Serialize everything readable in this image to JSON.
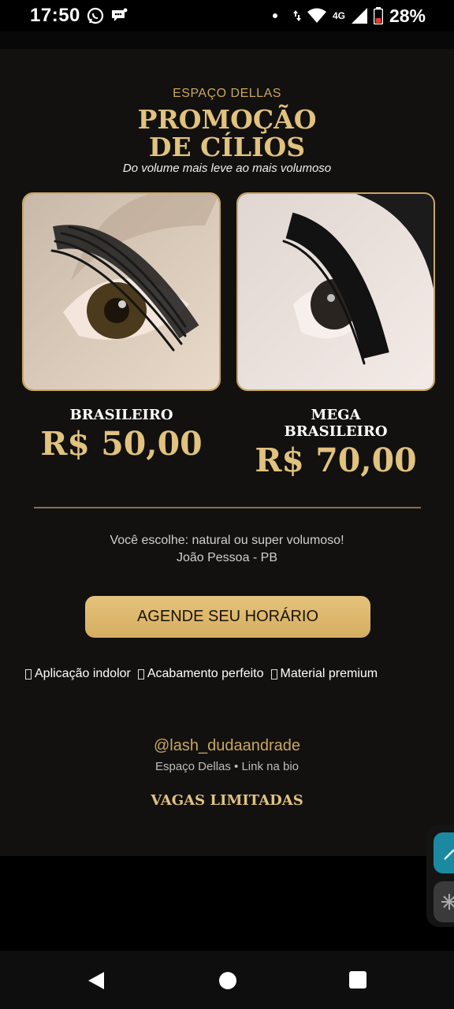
{
  "status_bar": {
    "time": "17:50",
    "network": "4G",
    "battery": "28%",
    "icons": [
      "whatsapp-icon",
      "message-icon",
      "dot-icon",
      "data-arrows-icon",
      "wifi-icon",
      "signal-icon",
      "battery-icon"
    ]
  },
  "promo": {
    "brand": "ESPAÇO DELLAS",
    "title_line1": "PROMOÇÃO",
    "title_line2": "DE CÍLIOS",
    "subtitle": "Do volume mais leve ao mais volumoso",
    "options": [
      {
        "name": "BRASILEIRO",
        "price": "R$ 50,00"
      },
      {
        "name_line1": "MEGA",
        "name_line2": "BRASILEIRO",
        "price": "R$ 70,00"
      }
    ],
    "tagline": "Você escolhe: natural ou super volumoso!",
    "location": "João Pessoa - PB",
    "cta": "AGENDE SEU HORÁRIO",
    "features": [
      "Aplicação indolor",
      "Acabamento perfeito",
      "Material premium"
    ],
    "handle": "@lash_dudaandrade",
    "info": "Espaço Dellas • Link na bio",
    "footer": "VAGAS LIMITADAS"
  },
  "colors": {
    "gold": "#e1c27e",
    "card_bg": "#121110",
    "accent_fab": "#1b8aa0"
  }
}
